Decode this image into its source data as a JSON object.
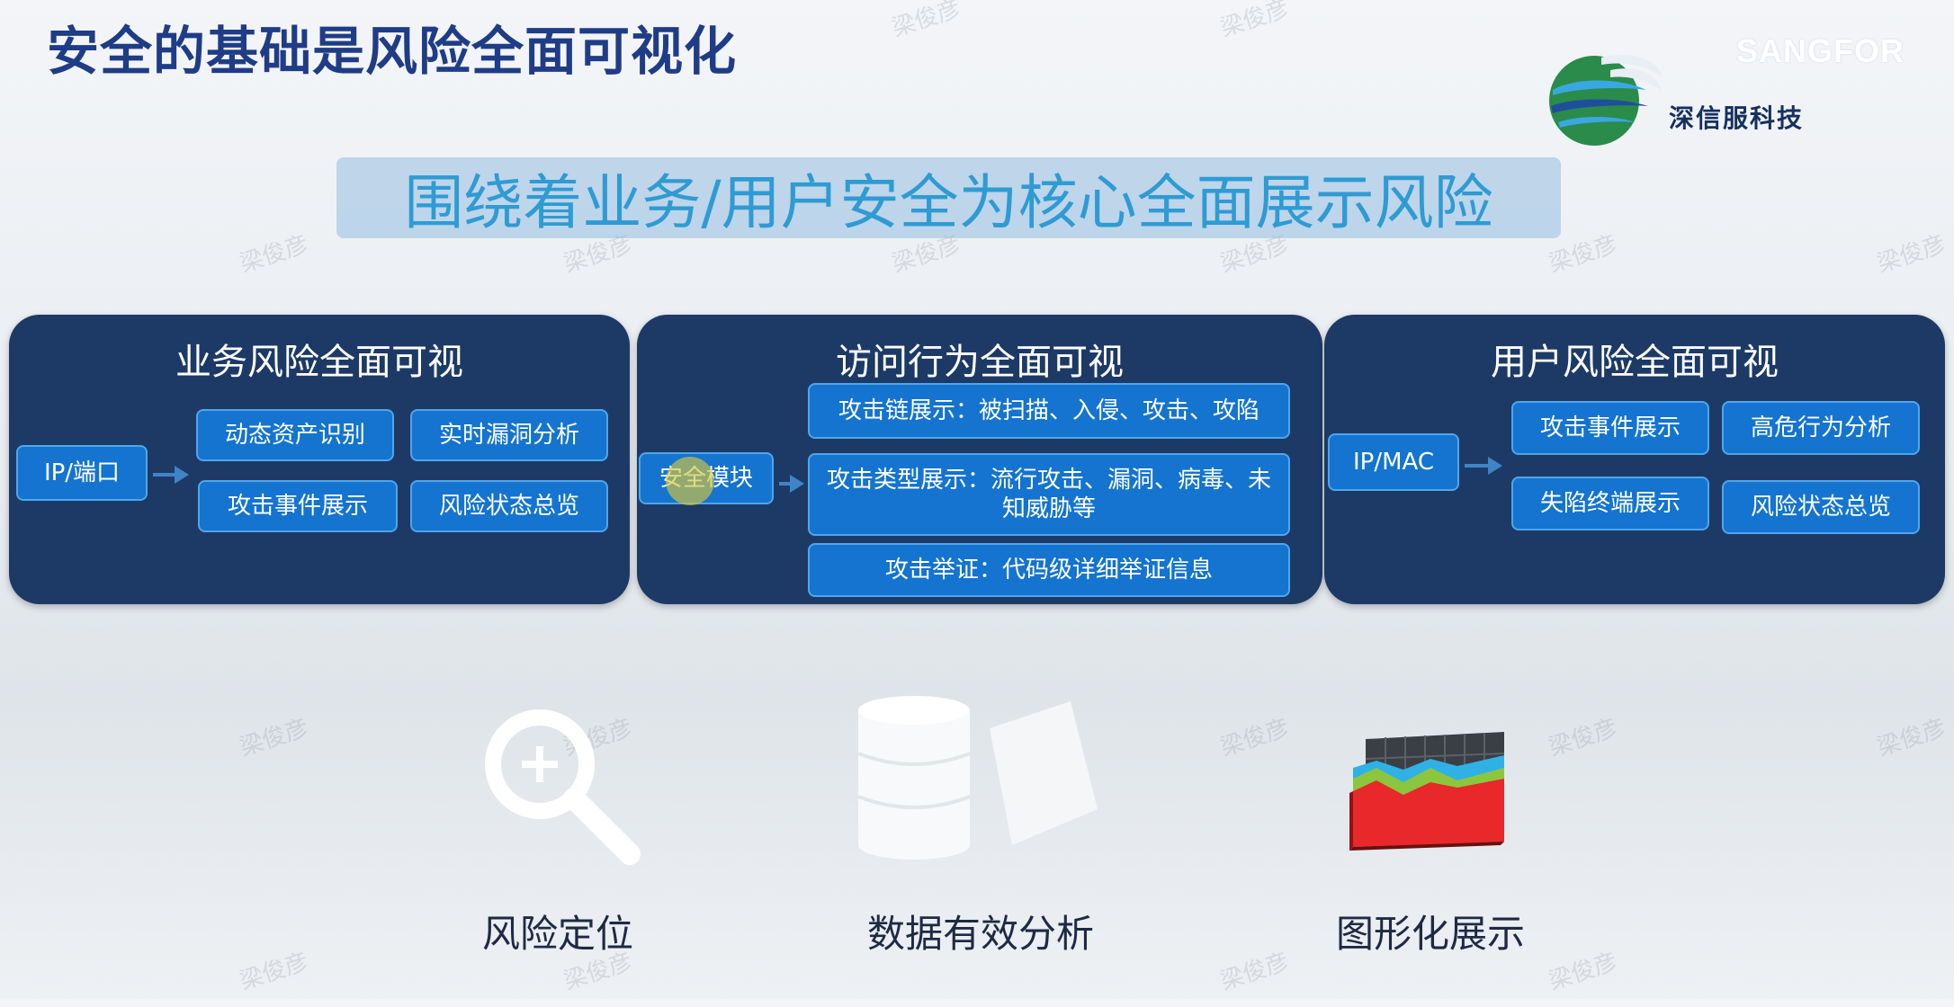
{
  "title": "安全的基础是风险全面可视化",
  "logo": {
    "en": "SANGFOR",
    "cn": "深信服科技"
  },
  "banner": "围绕着业务/用户安全为核心全面展示风险",
  "panels": [
    {
      "title": "业务风险全面可视",
      "source": "IP/端口",
      "items": [
        "动态资产识别",
        "实时漏洞分析",
        "攻击事件展示",
        "风险状态总览"
      ]
    },
    {
      "title": "访问行为全面可视",
      "source": "安全模块",
      "items": [
        "攻击链展示：被扫描、入侵、攻击、攻陷",
        "攻击类型展示：流行攻击、漏洞、病毒、未知威胁等",
        "攻击举证：代码级详细举证信息"
      ]
    },
    {
      "title": "用户风险全面可视",
      "source": "IP/MAC",
      "items": [
        "攻击事件展示",
        "高危行为分析",
        "失陷终端展示",
        "风险状态总览"
      ]
    }
  ],
  "features": [
    {
      "label": "风险定位",
      "icon": "magnifier-plus-icon"
    },
    {
      "label": "数据有效分析",
      "icon": "database-document-icon"
    },
    {
      "label": "图形化展示",
      "icon": "area-chart-icon"
    }
  ],
  "watermark": "梁俊彦",
  "colors": {
    "title": "#1f3c86",
    "panel": "#1d3a66",
    "box": "#1474cf",
    "banner_text": "#2f9bd3"
  }
}
